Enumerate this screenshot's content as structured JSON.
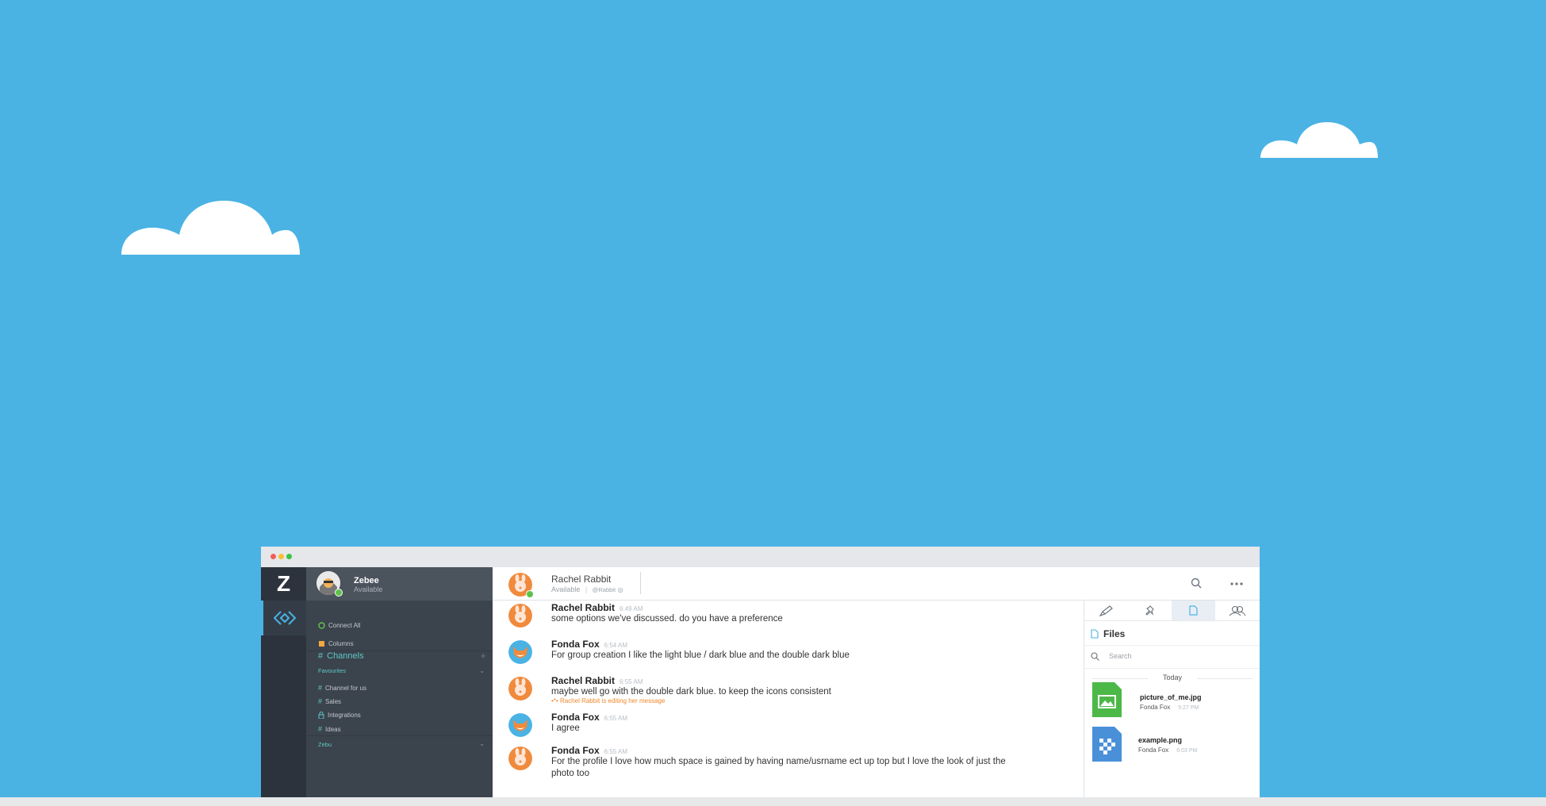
{
  "background_color": "#4ab3e4",
  "sidebar": {
    "logo": "Z",
    "user": {
      "name": "Zebee",
      "status": "Available"
    },
    "menu": [
      {
        "label": "Connect All",
        "icon": "connect-icon"
      },
      {
        "label": "Columns",
        "icon": "columns-icon"
      }
    ],
    "channels_title": "Channels",
    "favourites_label": "Favourites",
    "channels": [
      {
        "label": "Channel for us",
        "icon": "hash-icon"
      },
      {
        "label": "Sales",
        "icon": "hash-icon"
      },
      {
        "label": "Integrations",
        "icon": "lock-icon"
      },
      {
        "label": "Ideas",
        "icon": "hash-icon"
      }
    ],
    "group_label": "Zebu"
  },
  "chat": {
    "contact_name": "Rachel Rabbit",
    "contact_status": "Available",
    "contact_handle": "@Rabbit",
    "messages": [
      {
        "author": "Rachel Rabbit",
        "time": "6:49 AM",
        "text": "some options we've discussed.  do you have a preference"
      },
      {
        "author": "Fonda Fox",
        "time": "6:54 AM",
        "text": "For group creation I like the light blue / dark blue and the double dark blue"
      },
      {
        "author": "Rachel Rabbit",
        "time": "6:55 AM",
        "text": "maybe well go with the double dark blue. to keep the icons consistent",
        "note": "•*• Rachel Rabbit is editing her message"
      },
      {
        "author": "Fonda Fox",
        "time": "6:55 AM",
        "text": "I agree"
      },
      {
        "author": "Fonda Fox",
        "time": "6:55 AM",
        "text": "For the profile I love how much space is gained by having name/usrname ect up top but I love the look of just the photo too"
      }
    ]
  },
  "files_panel": {
    "title": "Files",
    "search_placeholder": "Search",
    "today_label": "Today",
    "files": [
      {
        "name": "picture_of_me.jpg",
        "owner": "Fonda Fox",
        "time": "5:27 PM",
        "color": "#4cb848"
      },
      {
        "name": "example.png",
        "owner": "Fonda Fox",
        "time": "6:03 PM",
        "color": "#4a90d9"
      }
    ]
  }
}
